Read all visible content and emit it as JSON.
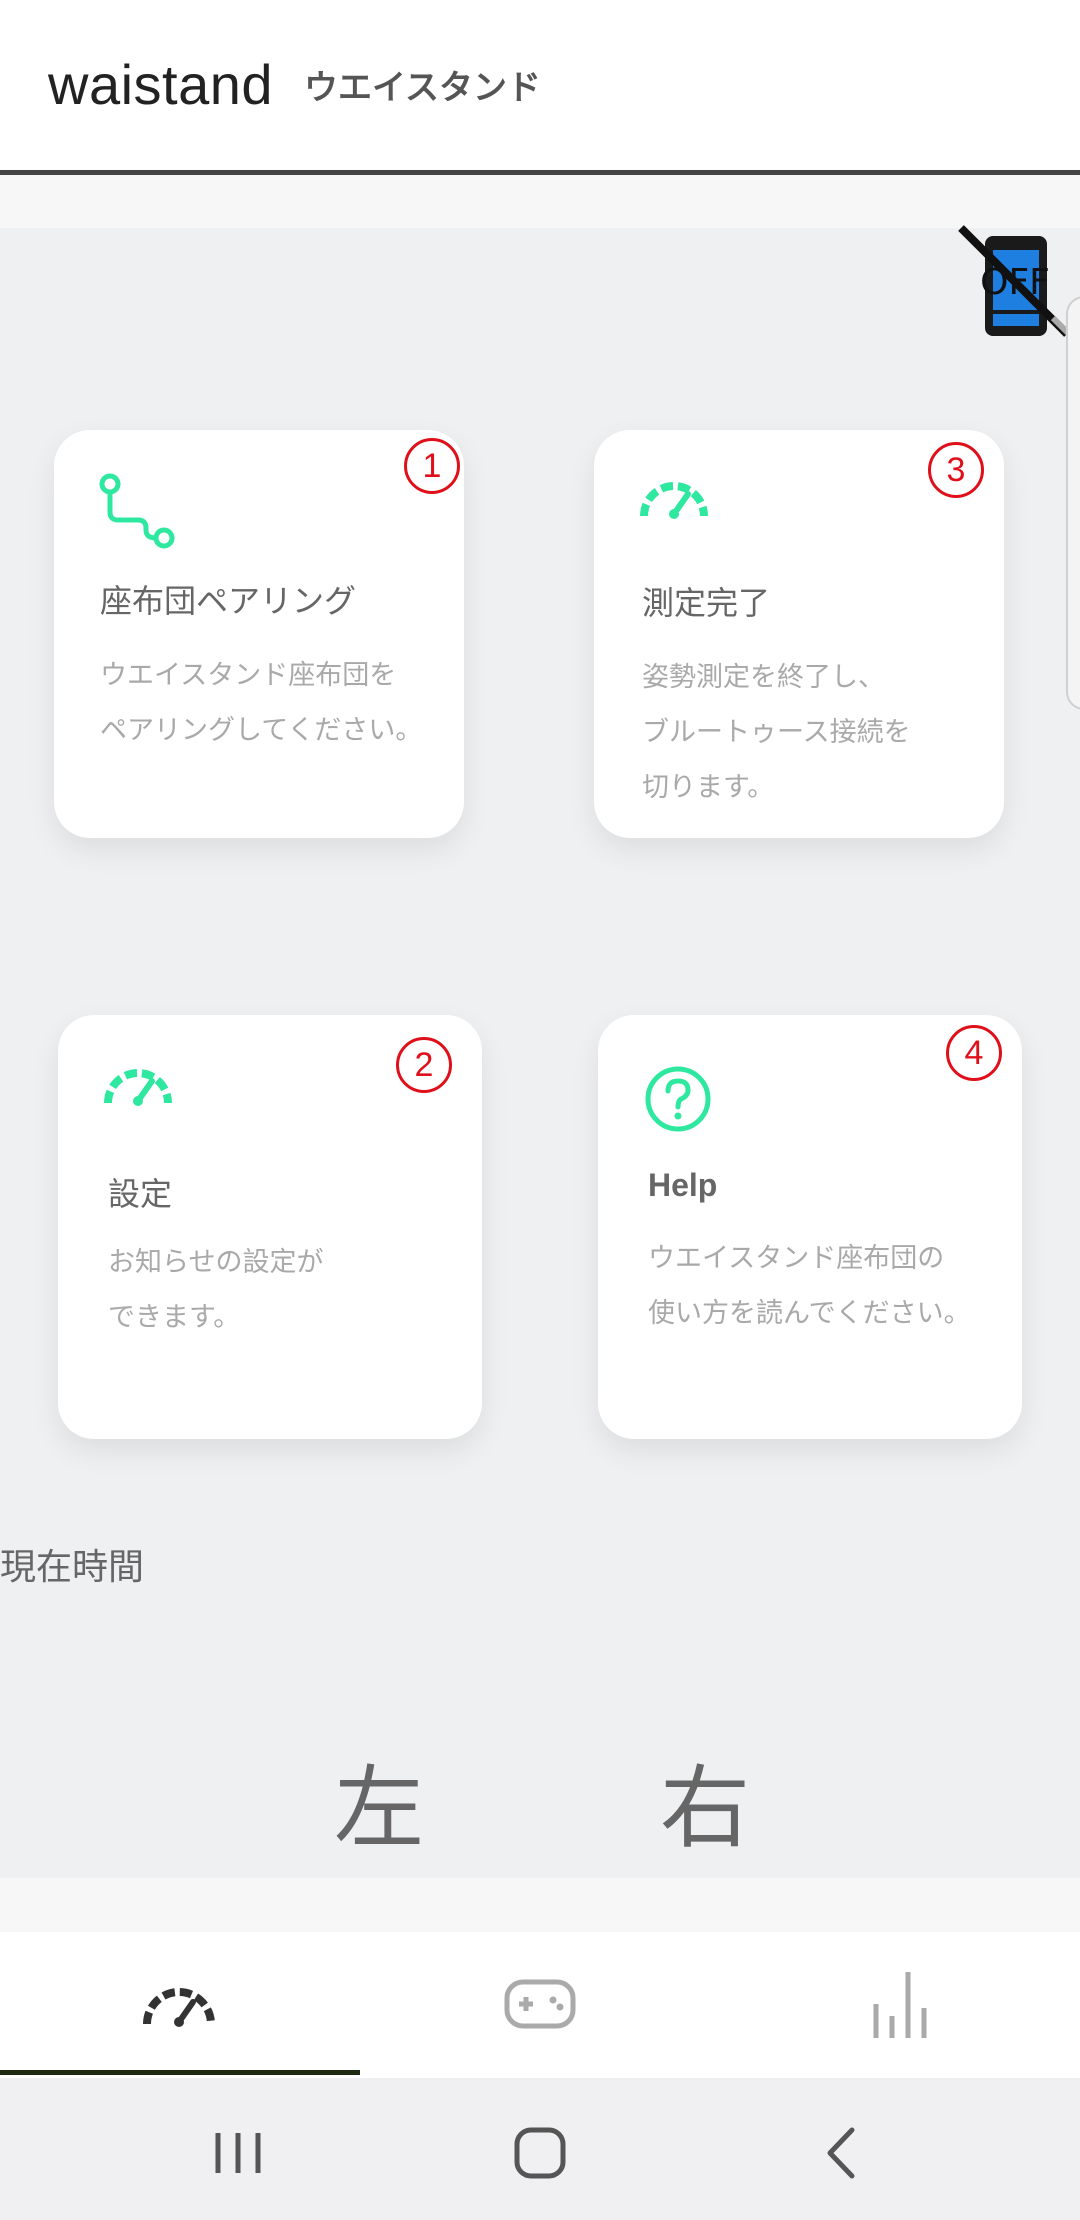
{
  "header": {
    "title": "waistand",
    "subtitle": "ウエイスタンド"
  },
  "status": {
    "bluetooth_icon": "phone-off-icon",
    "bluetooth_text": "OFF"
  },
  "cards": [
    {
      "id": "pairing",
      "badge": "1",
      "icon": "route-icon",
      "title": "座布団ペアリング",
      "desc": "ウエイスタンド座布団を\nペアリングしてください。"
    },
    {
      "id": "finish",
      "badge": "3",
      "icon": "speedometer-icon",
      "title": "測定完了",
      "desc": "姿勢測定を終了し、\nブルートゥース接続を\n切ります。"
    },
    {
      "id": "settings",
      "badge": "2",
      "icon": "speedometer-icon",
      "title": "設定",
      "desc": "お知らせの設定が\nできます。"
    },
    {
      "id": "help",
      "badge": "4",
      "icon": "help-circle-icon",
      "title": "Help",
      "desc": "ウエイスタンド座布団の\n使い方を読んでください。"
    }
  ],
  "time": {
    "label": "現在時間"
  },
  "sides": {
    "left": "左",
    "right": "右"
  },
  "bottom_nav": {
    "tabs": [
      {
        "icon": "speedometer-icon",
        "active": true
      },
      {
        "icon": "gamepad-icon",
        "active": false
      },
      {
        "icon": "bar-chart-icon",
        "active": false
      }
    ]
  },
  "colors": {
    "accent_green": "#2ee8a0",
    "badge_red": "#e0101a",
    "nav_indicator": "#1f2a12"
  }
}
